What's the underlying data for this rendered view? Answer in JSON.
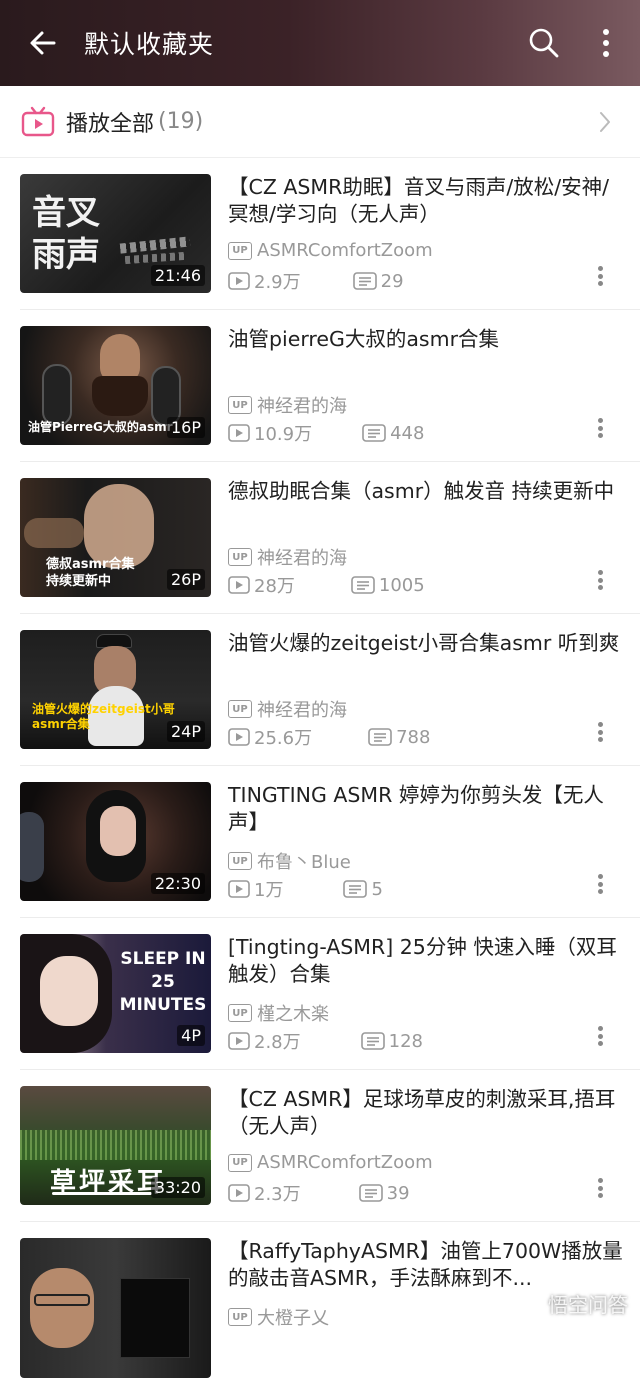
{
  "header": {
    "title": "默认收藏夹"
  },
  "play_all": {
    "label": "播放全部",
    "count": "(19)"
  },
  "colors": {
    "header_gradient_start": "#2a1a1d",
    "header_gradient_end": "#7a5a60",
    "accent_pink": "#e8578a",
    "meta_gray": "#999999"
  },
  "videos": [
    {
      "title": "【CZ ASMR助眠】音叉与雨声/放松/安神/冥想/学习向（无人声）",
      "uploader": "ASMRComfortZoom",
      "views": "2.9万",
      "comments": "29",
      "badge": "21:46",
      "thumb_text": "音叉\n雨声"
    },
    {
      "title": "油管pierreG大叔的asmr合集",
      "uploader": "神经君的海",
      "views": "10.9万",
      "comments": "448",
      "badge": "16P",
      "thumb_text": "油管PierreG大叔的asmr"
    },
    {
      "title": "德叔助眠合集（asmr）触发音 持续更新中",
      "uploader": "神经君的海",
      "views": "28万",
      "comments": "1005",
      "badge": "26P",
      "thumb_text": "德叔asmr合集\n持续更新中"
    },
    {
      "title": "油管火爆的zeitgeist小哥合集asmr 听到爽",
      "uploader": "神经君的海",
      "views": "25.6万",
      "comments": "788",
      "badge": "24P",
      "thumb_text": "油管火爆的zeitgeist小哥asmr合集"
    },
    {
      "title": "TINGTING ASMR 婷婷为你剪头发【无人声】",
      "uploader": "布鲁丶Blue",
      "views": "1万",
      "comments": "5",
      "badge": "22:30",
      "thumb_text": ""
    },
    {
      "title": "[Tingting-ASMR] 25分钟 快速入睡（双耳触发）合集",
      "uploader": "槿之木楽",
      "views": "2.8万",
      "comments": "128",
      "badge": "4P",
      "thumb_text": "SLEEP IN\n25\nMINUTES"
    },
    {
      "title": "【CZ ASMR】足球场草皮的刺激采耳,捂耳（无人声）",
      "uploader": "ASMRComfortZoom",
      "views": "2.3万",
      "comments": "39",
      "badge": "33:20",
      "thumb_text": "草坪采耳"
    },
    {
      "title": "【RaffyTaphyASMR】油管上700W播放量的敲击音ASMR，手法酥麻到不...",
      "uploader": "大橙子乂",
      "views": "",
      "comments": "",
      "badge": "",
      "thumb_text": ""
    }
  ],
  "watermark": "悟空问答",
  "up_label": "UP"
}
